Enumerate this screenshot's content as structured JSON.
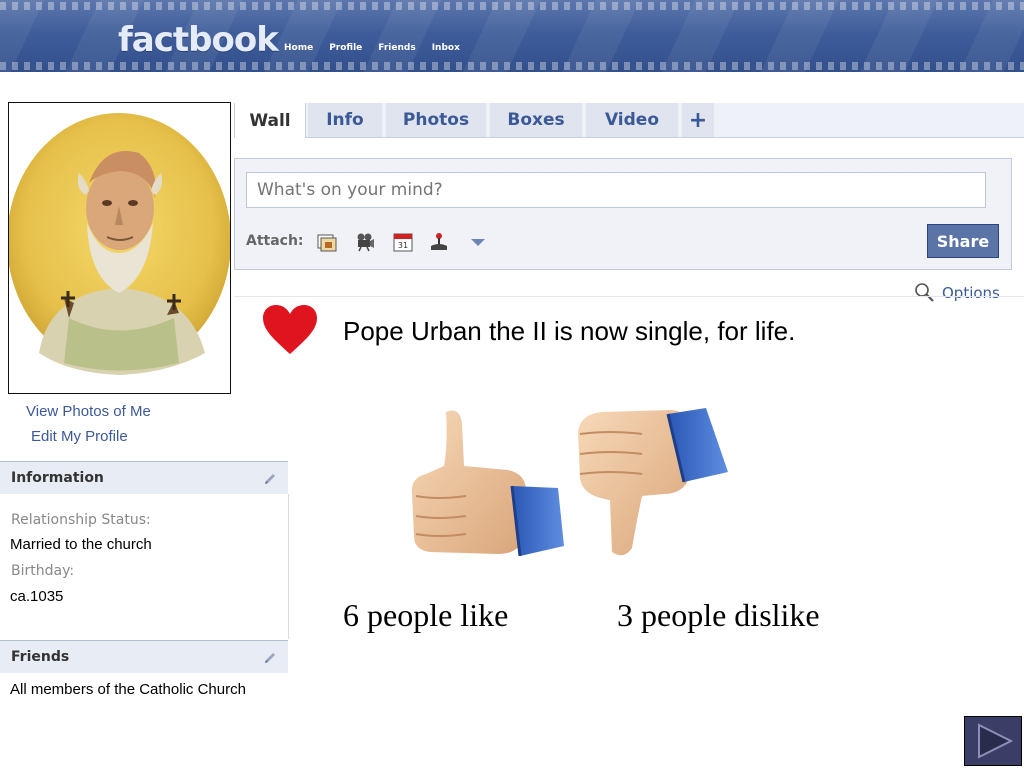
{
  "header": {
    "logo": "factbook",
    "nav": [
      "Home",
      "Profile",
      "Friends",
      "Inbox"
    ]
  },
  "sidebar": {
    "links": [
      "View Photos of Me",
      "Edit My Profile"
    ],
    "information": {
      "title": "Information",
      "relationship_label": "Relationship Status:",
      "relationship_value": "Married to the church",
      "birthday_label": "Birthday:",
      "birthday_value": "ca.1035"
    },
    "friends": {
      "title": "Friends",
      "value": "All members of the Catholic Church"
    }
  },
  "tabs": [
    "Wall",
    "Info",
    "Photos",
    "Boxes",
    "Video",
    "+"
  ],
  "composer": {
    "placeholder": "What's on your mind?",
    "attach_label": "Attach:",
    "share_label": "Share",
    "options_label": "Options"
  },
  "post": {
    "text": "Pope Urban the II is now single, for life.",
    "like_count": "6 people like",
    "dislike_count": "3 people dislike"
  },
  "colors": {
    "brand_blue": "#3b5998",
    "header_blue": "#3f5d9a",
    "share_button": "#5b74a8",
    "heart_red": "#e0141e"
  },
  "icons": [
    "photo-icon",
    "video-camera-icon",
    "calendar-icon",
    "joystick-icon",
    "dropdown-arrow-icon",
    "magnifier-icon",
    "pencil-icon",
    "heart-icon",
    "thumbs-up-icon",
    "thumbs-down-icon",
    "play-next-icon"
  ]
}
